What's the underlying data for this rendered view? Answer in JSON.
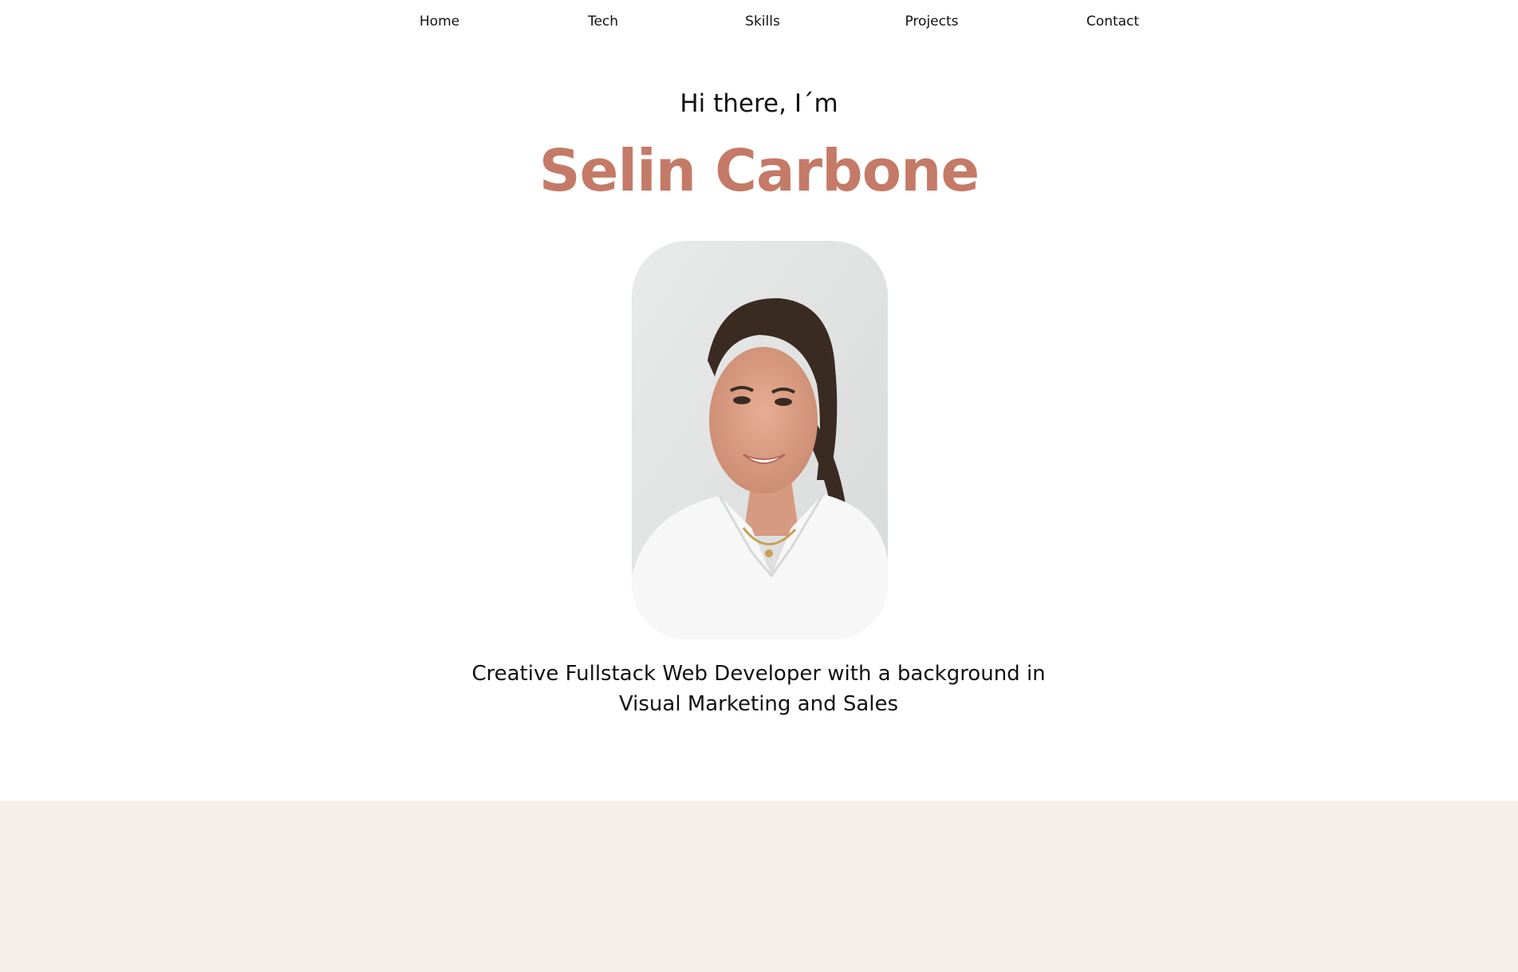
{
  "nav": {
    "items": [
      {
        "label": "Home"
      },
      {
        "label": "Tech"
      },
      {
        "label": "Skills"
      },
      {
        "label": "Projects"
      },
      {
        "label": "Contact"
      }
    ]
  },
  "hero": {
    "greeting": "Hi there, I´m",
    "name": "Selin Carbone",
    "portrait_icon": "portrait-photo",
    "tagline": "Creative Fullstack Web Developer with a background in Visual Marketing and Sales"
  },
  "colors": {
    "accent": "#c47a67",
    "section_bg": "#f6eee9",
    "text": "#111111"
  }
}
